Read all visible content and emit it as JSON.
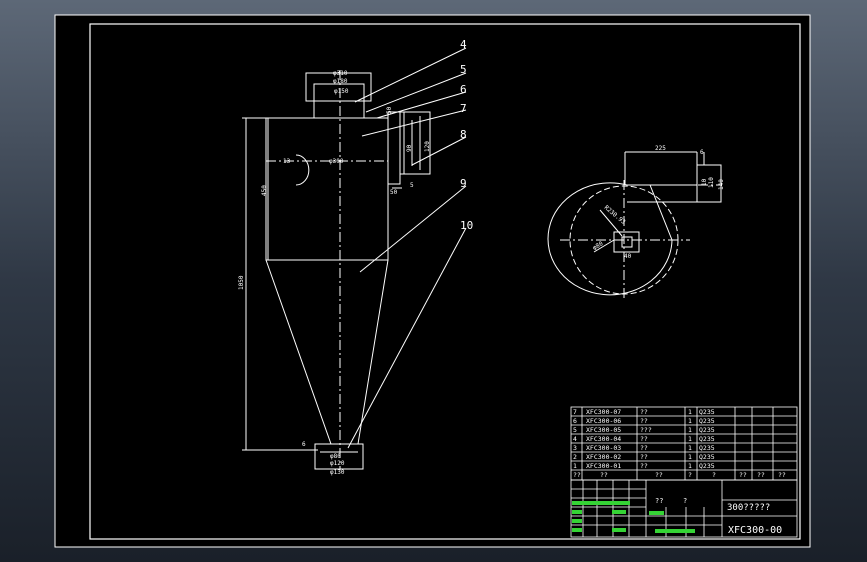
{
  "part_numbers": [
    "4",
    "5",
    "6",
    "7",
    "8",
    "9",
    "10"
  ],
  "dims": {
    "outlet_d1": "φ310",
    "outlet_d2": "φ180",
    "outlet_d3": "φ150",
    "body_d": "φ300",
    "cyl_h": "450",
    "total_h": "1050",
    "angle": "13",
    "inlet_w": "50",
    "inlet_h1": "120",
    "inlet_h2": "90",
    "inlet_b": "5",
    "inlet_c": "50",
    "bottom_d1": "φ80",
    "bottom_d2": "φ120",
    "bottom_d3": "φ130",
    "bottom_t": "6",
    "top_w": "225",
    "top_t": "6",
    "top_h1": "140",
    "top_h2": "110",
    "top_h3": "10",
    "radius_r": "R230.93",
    "r_small": "φ80",
    "r_small2": "40"
  },
  "bom": {
    "rows": [
      {
        "no": "7",
        "code": "XFC300-07",
        "name": "??",
        "qty": "1",
        "mat": "Q235"
      },
      {
        "no": "6",
        "code": "XFC300-06",
        "name": "??",
        "qty": "1",
        "mat": "Q235"
      },
      {
        "no": "5",
        "code": "XFC300-05",
        "name": "???",
        "qty": "1",
        "mat": "Q235"
      },
      {
        "no": "4",
        "code": "XFC300-04",
        "name": "??",
        "qty": "1",
        "mat": "Q235"
      },
      {
        "no": "3",
        "code": "XFC300-03",
        "name": "??",
        "qty": "1",
        "mat": "Q235"
      },
      {
        "no": "2",
        "code": "XFC300-02",
        "name": "??",
        "qty": "1",
        "mat": "Q235"
      },
      {
        "no": "1",
        "code": "XFC300-01",
        "name": "??",
        "qty": "1",
        "mat": "Q235"
      }
    ],
    "header": [
      "??",
      "??",
      "??",
      "?",
      "?",
      "??",
      "??",
      "??"
    ]
  },
  "title_block": {
    "title": "300?????",
    "drawing_no": "XFC300-00",
    "label_a": "??",
    "label_b": "?"
  },
  "colors": {
    "frame": "#ffffff",
    "line": "#ffffff",
    "text": "#ffffff",
    "green": "#35d335",
    "background": "#000000"
  }
}
